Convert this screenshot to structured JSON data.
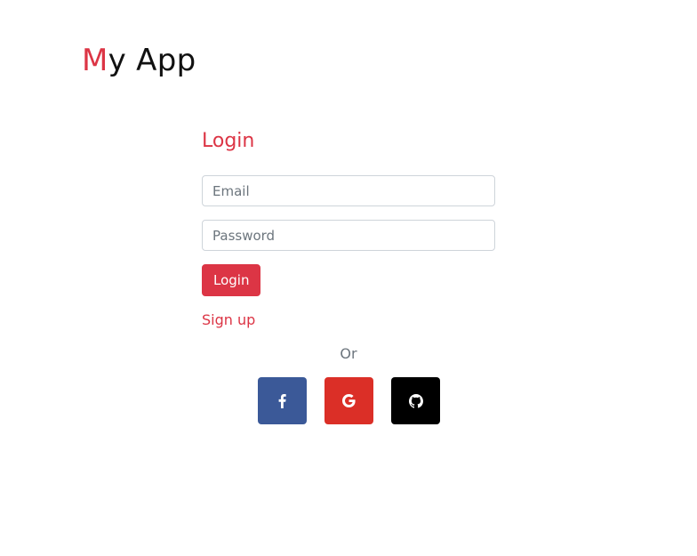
{
  "brand": {
    "first_letter": "M",
    "rest": "y App",
    "accent_color": "#dc3545"
  },
  "login": {
    "title": "Login",
    "email_placeholder": "Email",
    "password_placeholder": "Password",
    "login_button_label": "Login",
    "signup_link": "Sign up"
  },
  "divider_text": "Or",
  "social": [
    {
      "provider": "facebook",
      "icon": "facebook-icon",
      "color": "#3b5998"
    },
    {
      "provider": "google",
      "icon": "google-icon",
      "color": "#db2f27"
    },
    {
      "provider": "github",
      "icon": "github-icon",
      "color": "#000000"
    }
  ]
}
